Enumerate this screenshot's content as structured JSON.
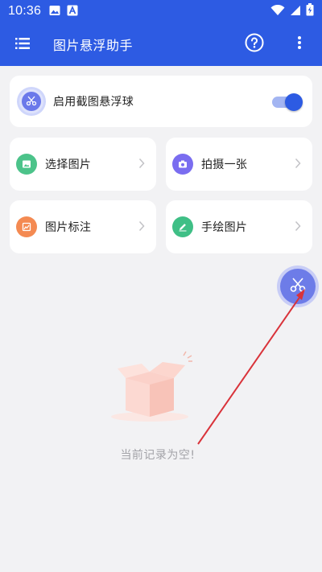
{
  "status_bar": {
    "time": "10:36",
    "left_icons": [
      "image-icon",
      "font-icon"
    ],
    "right_icons": [
      "wifi-icon",
      "signal-icon",
      "battery-charging-icon"
    ]
  },
  "app_bar": {
    "title": "图片悬浮助手",
    "menu_icon": "menu-icon",
    "help_icon": "help-circle-icon",
    "more_icon": "more-vert-icon"
  },
  "float_toggle": {
    "label": "启用截图悬浮球",
    "icon": "scissors-icon",
    "enabled": true
  },
  "actions": [
    {
      "label": "选择图片",
      "icon": "image-icon",
      "color": "#4cc38a"
    },
    {
      "label": "拍摄一张",
      "icon": "camera-icon",
      "color": "#7a6df0"
    },
    {
      "label": "图片标注",
      "icon": "annotate-icon",
      "color": "#f48a52"
    },
    {
      "label": "手绘图片",
      "icon": "pen-icon",
      "color": "#3fbf86"
    }
  ],
  "empty_state": {
    "text": "当前记录为空!",
    "icon": "empty-box-icon"
  },
  "fab": {
    "icon": "scissors-icon"
  },
  "colors": {
    "primary": "#2d5be3",
    "background": "#f2f2f4",
    "annotation_arrow": "#d9333a"
  }
}
